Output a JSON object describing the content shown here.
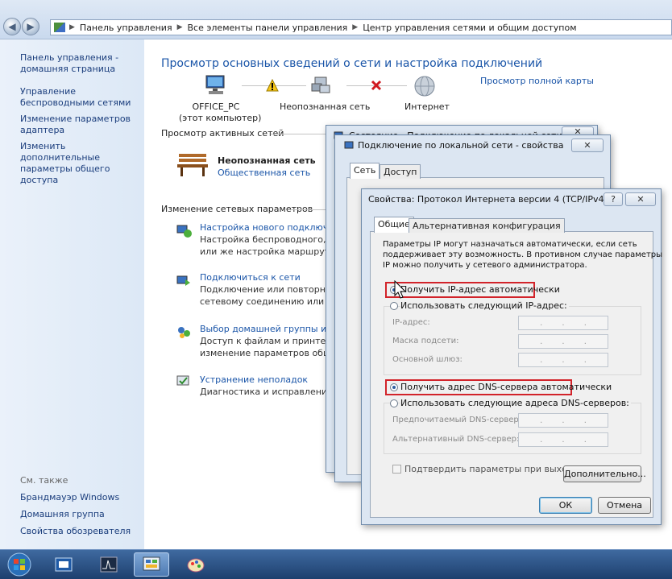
{
  "address_bar": {
    "crumbs": [
      "Панель управления",
      "Все элементы панели управления",
      "Центр управления сетями и общим доступом"
    ]
  },
  "sidebar": {
    "home": "Панель управления - домашняя страница",
    "items": [
      "Управление беспроводными сетями",
      "Изменение параметров адаптера",
      "Изменить дополнительные параметры общего доступа"
    ],
    "see_also_title": "См. также",
    "see_also": [
      "Брандмауэр Windows",
      "Домашняя группа",
      "Свойства обозревателя"
    ]
  },
  "main": {
    "title": "Просмотр основных сведений о сети и настройка подключений",
    "full_map_link": "Просмотр полной карты",
    "map": {
      "computer_name": "OFFICE_PC",
      "computer_sub": "(этот компьютер)",
      "network": "Неопознанная сеть",
      "internet": "Интернет"
    },
    "active_networks_header": "Просмотр активных сетей",
    "active_network": {
      "name": "Неопознанная сеть",
      "type": "Общественная сеть"
    },
    "change_settings_header": "Изменение сетевых параметров",
    "tasks": [
      {
        "link": "Настройка нового подключения",
        "desc1": "Настройка беспроводного, широкополосного",
        "desc2": "или же настройка маршрутизатора"
      },
      {
        "link": "Подключиться к сети",
        "desc1": "Подключение или повторное подключение к",
        "desc2": "сетевому соединению или подключение"
      },
      {
        "link": "Выбор домашней группы и параметров общего доступа",
        "desc1": "Доступ к файлам и принтерам, расположенным",
        "desc2": "изменение параметров общего доступа"
      },
      {
        "link": "Устранение неполадок",
        "desc1": "Диагностика и исправление сетевых проблем",
        "desc2": ""
      }
    ]
  },
  "window_status": {
    "title": "Состояние - Подключение по локальной сети"
  },
  "window_props": {
    "title": "Подключение по локальной сети - свойства",
    "tabs": [
      "Сеть",
      "Доступ"
    ]
  },
  "dialog_ipv4": {
    "title": "Свойства: Протокол Интернета версии 4 (TCP/IPv4)",
    "help_btn": "?",
    "close_btn": "✕",
    "tabs": [
      "Общие",
      "Альтернативная конфигурация"
    ],
    "description": [
      "Параметры IP могут назначаться автоматически, если сеть",
      "поддерживает эту возможность. В противном случае параметры",
      "IP можно получить у сетевого администратора."
    ],
    "ip_auto": "Получить IP-адрес автоматически",
    "ip_manual": "Использовать следующий IP-адрес:",
    "ip_fields": [
      "IP-адрес:",
      "Маска подсети:",
      "Основной шлюз:"
    ],
    "dns_auto": "Получить адрес DNS-сервера автоматически",
    "dns_manual": "Использовать следующие адреса DNS-серверов:",
    "dns_fields": [
      "Предпочитаемый DNS-сервер:",
      "Альтернативный DNS-сервер:"
    ],
    "validate": "Подтвердить параметры при выходе",
    "advanced_btn": "Дополнительно...",
    "ok_btn": "ОК",
    "cancel_btn": "Отмена"
  },
  "colors": {
    "accent": "#1a55a8",
    "highlight": "#d2232a",
    "taskbar": "#1d3f6e"
  }
}
